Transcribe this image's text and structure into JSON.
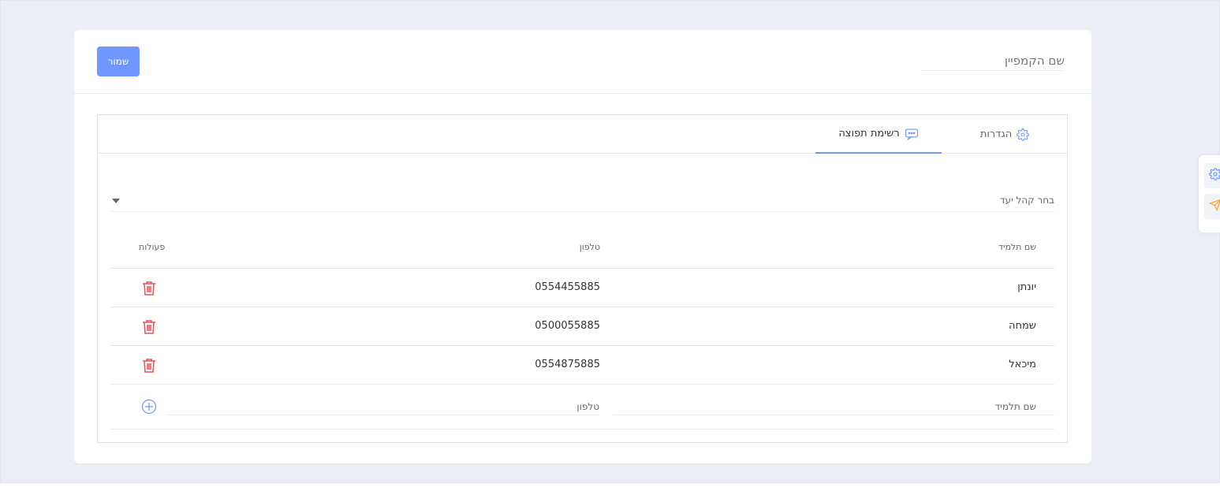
{
  "header": {
    "save_label": "שמור",
    "campaign_name_placeholder": "שם הקמפיין"
  },
  "tabs": [
    {
      "label": "הגדרות",
      "icon": "gear-icon"
    },
    {
      "label": "רשימת תפוצה",
      "icon": "message-dots-icon",
      "active": true
    }
  ],
  "audience": {
    "label": "בחר קהל יעד"
  },
  "table": {
    "columns": [
      "שם תלמיד",
      "טלפון",
      "פעולות"
    ],
    "rows": [
      {
        "name": "יונתן",
        "phone": "0554455885"
      },
      {
        "name": "שמחה",
        "phone": "0500055885"
      },
      {
        "name": "מיכאל",
        "phone": "0554875885"
      }
    ],
    "new_row": {
      "name_placeholder": "שם תלמיד",
      "phone_placeholder": "טלפון"
    }
  },
  "side_widget": {
    "icons": [
      "gear-icon",
      "send-icon"
    ]
  },
  "colors": {
    "accent": "#6f97ff",
    "delete": "#e8505b",
    "send": "#f5a623",
    "background": "#eceef5"
  }
}
